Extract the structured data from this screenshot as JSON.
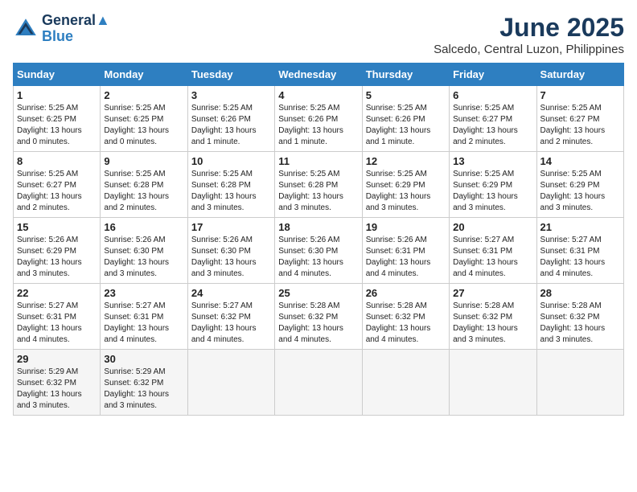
{
  "logo": {
    "line1": "General",
    "line2": "Blue"
  },
  "title": "June 2025",
  "location": "Salcedo, Central Luzon, Philippines",
  "weekdays": [
    "Sunday",
    "Monday",
    "Tuesday",
    "Wednesday",
    "Thursday",
    "Friday",
    "Saturday"
  ],
  "weeks": [
    [
      {
        "day": "1",
        "sunrise": "5:25 AM",
        "sunset": "6:25 PM",
        "daylight": "13 hours and 0 minutes."
      },
      {
        "day": "2",
        "sunrise": "5:25 AM",
        "sunset": "6:25 PM",
        "daylight": "13 hours and 0 minutes."
      },
      {
        "day": "3",
        "sunrise": "5:25 AM",
        "sunset": "6:26 PM",
        "daylight": "13 hours and 1 minute."
      },
      {
        "day": "4",
        "sunrise": "5:25 AM",
        "sunset": "6:26 PM",
        "daylight": "13 hours and 1 minute."
      },
      {
        "day": "5",
        "sunrise": "5:25 AM",
        "sunset": "6:26 PM",
        "daylight": "13 hours and 1 minute."
      },
      {
        "day": "6",
        "sunrise": "5:25 AM",
        "sunset": "6:27 PM",
        "daylight": "13 hours and 2 minutes."
      },
      {
        "day": "7",
        "sunrise": "5:25 AM",
        "sunset": "6:27 PM",
        "daylight": "13 hours and 2 minutes."
      }
    ],
    [
      {
        "day": "8",
        "sunrise": "5:25 AM",
        "sunset": "6:27 PM",
        "daylight": "13 hours and 2 minutes."
      },
      {
        "day": "9",
        "sunrise": "5:25 AM",
        "sunset": "6:28 PM",
        "daylight": "13 hours and 2 minutes."
      },
      {
        "day": "10",
        "sunrise": "5:25 AM",
        "sunset": "6:28 PM",
        "daylight": "13 hours and 3 minutes."
      },
      {
        "day": "11",
        "sunrise": "5:25 AM",
        "sunset": "6:28 PM",
        "daylight": "13 hours and 3 minutes."
      },
      {
        "day": "12",
        "sunrise": "5:25 AM",
        "sunset": "6:29 PM",
        "daylight": "13 hours and 3 minutes."
      },
      {
        "day": "13",
        "sunrise": "5:25 AM",
        "sunset": "6:29 PM",
        "daylight": "13 hours and 3 minutes."
      },
      {
        "day": "14",
        "sunrise": "5:25 AM",
        "sunset": "6:29 PM",
        "daylight": "13 hours and 3 minutes."
      }
    ],
    [
      {
        "day": "15",
        "sunrise": "5:26 AM",
        "sunset": "6:29 PM",
        "daylight": "13 hours and 3 minutes."
      },
      {
        "day": "16",
        "sunrise": "5:26 AM",
        "sunset": "6:30 PM",
        "daylight": "13 hours and 3 minutes."
      },
      {
        "day": "17",
        "sunrise": "5:26 AM",
        "sunset": "6:30 PM",
        "daylight": "13 hours and 3 minutes."
      },
      {
        "day": "18",
        "sunrise": "5:26 AM",
        "sunset": "6:30 PM",
        "daylight": "13 hours and 4 minutes."
      },
      {
        "day": "19",
        "sunrise": "5:26 AM",
        "sunset": "6:31 PM",
        "daylight": "13 hours and 4 minutes."
      },
      {
        "day": "20",
        "sunrise": "5:27 AM",
        "sunset": "6:31 PM",
        "daylight": "13 hours and 4 minutes."
      },
      {
        "day": "21",
        "sunrise": "5:27 AM",
        "sunset": "6:31 PM",
        "daylight": "13 hours and 4 minutes."
      }
    ],
    [
      {
        "day": "22",
        "sunrise": "5:27 AM",
        "sunset": "6:31 PM",
        "daylight": "13 hours and 4 minutes."
      },
      {
        "day": "23",
        "sunrise": "5:27 AM",
        "sunset": "6:31 PM",
        "daylight": "13 hours and 4 minutes."
      },
      {
        "day": "24",
        "sunrise": "5:27 AM",
        "sunset": "6:32 PM",
        "daylight": "13 hours and 4 minutes."
      },
      {
        "day": "25",
        "sunrise": "5:28 AM",
        "sunset": "6:32 PM",
        "daylight": "13 hours and 4 minutes."
      },
      {
        "day": "26",
        "sunrise": "5:28 AM",
        "sunset": "6:32 PM",
        "daylight": "13 hours and 4 minutes."
      },
      {
        "day": "27",
        "sunrise": "5:28 AM",
        "sunset": "6:32 PM",
        "daylight": "13 hours and 3 minutes."
      },
      {
        "day": "28",
        "sunrise": "5:28 AM",
        "sunset": "6:32 PM",
        "daylight": "13 hours and 3 minutes."
      }
    ],
    [
      {
        "day": "29",
        "sunrise": "5:29 AM",
        "sunset": "6:32 PM",
        "daylight": "13 hours and 3 minutes."
      },
      {
        "day": "30",
        "sunrise": "5:29 AM",
        "sunset": "6:32 PM",
        "daylight": "13 hours and 3 minutes."
      },
      null,
      null,
      null,
      null,
      null
    ]
  ]
}
